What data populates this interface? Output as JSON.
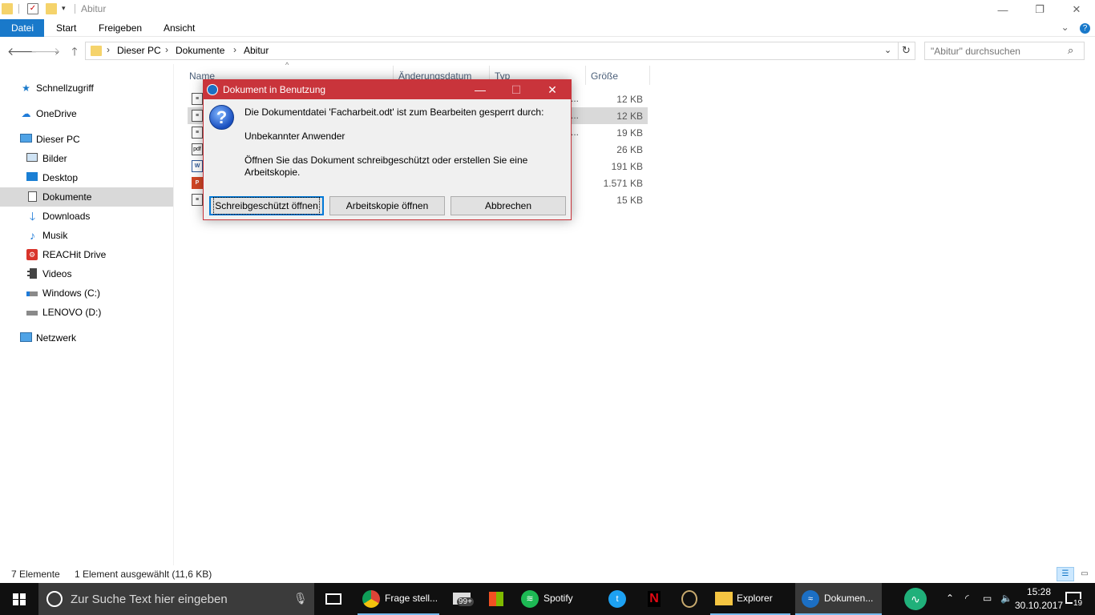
{
  "window": {
    "title": "Abitur",
    "minimize_glyph": "—",
    "restore_glyph": "❐",
    "close_glyph": "✕"
  },
  "ribbon": {
    "tabs": [
      "Datei",
      "Start",
      "Freigeben",
      "Ansicht"
    ],
    "active_tab": "Datei",
    "expand_glyph": "⌄",
    "help_glyph": "?"
  },
  "address": {
    "crumbs": [
      "Dieser PC",
      "Dokumente",
      "Abitur"
    ],
    "separator": "›",
    "search_placeholder": "\"Abitur\" durchsuchen"
  },
  "nav": {
    "items": [
      {
        "label": "Schnellzugriff",
        "icon": "star-icon"
      },
      {
        "label": "OneDrive",
        "icon": "cloud-icon"
      },
      {
        "label": "Dieser PC",
        "icon": "computer-icon"
      },
      {
        "label": "Bilder",
        "icon": "pictures-icon"
      },
      {
        "label": "Desktop",
        "icon": "desktop-icon"
      },
      {
        "label": "Dokumente",
        "icon": "documents-icon"
      },
      {
        "label": "Downloads",
        "icon": "download-icon"
      },
      {
        "label": "Musik",
        "icon": "music-icon"
      },
      {
        "label": "REACHit Drive",
        "icon": "reachit-icon"
      },
      {
        "label": "Videos",
        "icon": "video-icon"
      },
      {
        "label": "Windows (C:)",
        "icon": "drive-icon"
      },
      {
        "label": "LENOVO (D:)",
        "icon": "drive-icon"
      },
      {
        "label": "Netzwerk",
        "icon": "network-icon"
      }
    ],
    "selected": "Dokumente"
  },
  "columns": {
    "name": "Name",
    "date": "Änderungsdatum",
    "type": "Typ",
    "size": "Größe"
  },
  "files": [
    {
      "size": "12 KB",
      "icon": "odt-file-icon",
      "selected": false
    },
    {
      "size": "12 KB",
      "icon": "odt-file-icon",
      "selected": true
    },
    {
      "size": "19 KB",
      "icon": "odt-file-icon",
      "selected": false
    },
    {
      "size": "26 KB",
      "icon": "pdf-file-icon",
      "selected": false
    },
    {
      "size": "191 KB",
      "icon": "word-file-icon",
      "selected": false
    },
    {
      "size": "1.571 KB",
      "icon": "powerpoint-file-icon",
      "selected": false
    },
    {
      "size": "15 KB",
      "icon": "odt-file-icon",
      "selected": false
    }
  ],
  "file_type_truncated": "...",
  "status": {
    "count": "7 Elemente",
    "selection": "1 Element ausgewählt (11,6 KB)"
  },
  "dialog": {
    "title": "Dokument in Benutzung",
    "line1": "Die Dokumentdatei 'Facharbeit.odt' ist zum Bearbeiten gesperrt durch:",
    "line2": "Unbekannter Anwender",
    "line3": "Öffnen Sie das Dokument schreibgeschützt oder erstellen Sie eine Arbeitskopie.",
    "buttons": {
      "readonly": "Schreibgeschützt öffnen",
      "copy": "Arbeitskopie öffnen",
      "cancel": "Abbrechen"
    },
    "accent_color": "#c9343b"
  },
  "taskbar": {
    "search_placeholder": "Zur Suche Text hier eingeben",
    "apps": [
      {
        "label": "Frage stell...",
        "icon": "chrome-icon"
      },
      {
        "label": "",
        "icon": "mail-icon",
        "badge": "99+"
      },
      {
        "label": "",
        "icon": "store-icon"
      },
      {
        "label": "Spotify",
        "icon": "spotify-icon"
      },
      {
        "label": "",
        "icon": "twitter-icon"
      },
      {
        "label": "",
        "icon": "netflix-icon"
      },
      {
        "label": "",
        "icon": "league-icon"
      },
      {
        "label": "Explorer",
        "icon": "folder-icon"
      },
      {
        "label": "Dokumen...",
        "icon": "libreoffice-icon"
      }
    ],
    "clock_time": "15:28",
    "clock_date": "30.10.2017",
    "notification_count": "19"
  }
}
